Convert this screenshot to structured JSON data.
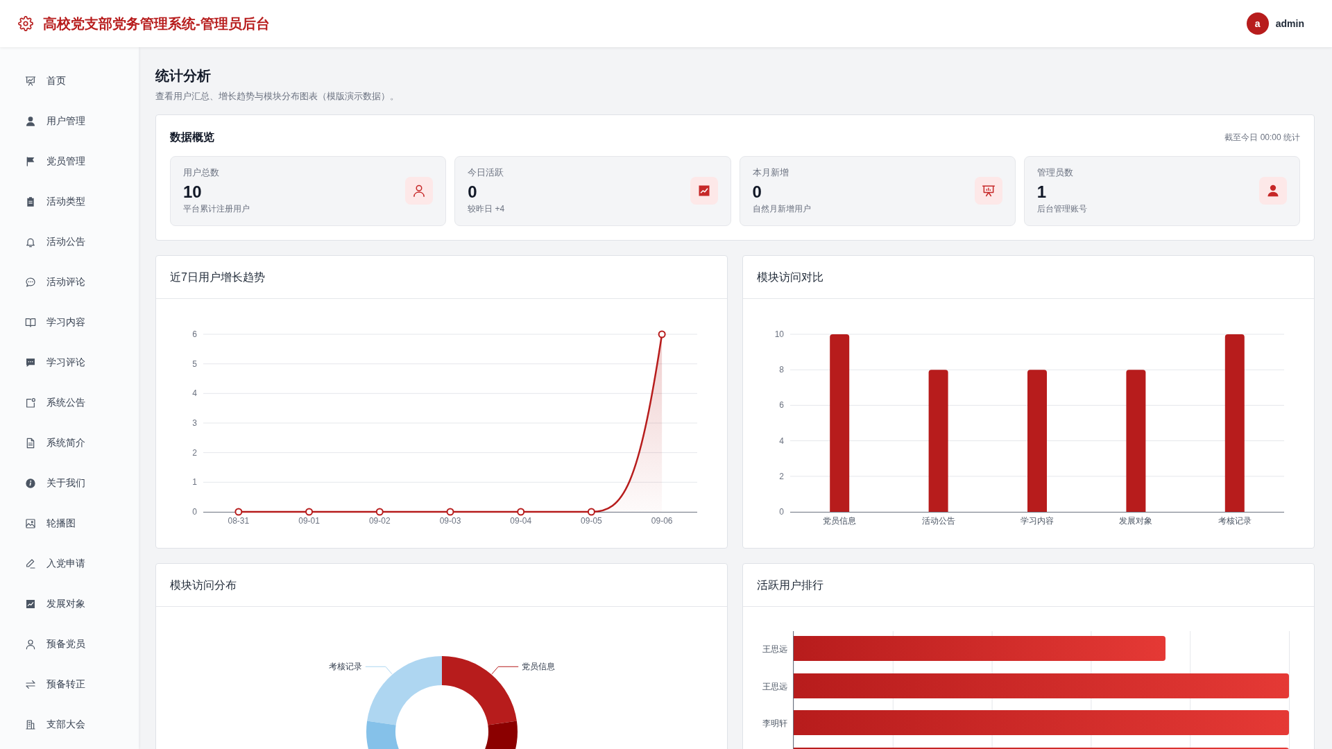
{
  "header": {
    "title": "高校党支部党务管理系统-管理员后台",
    "user": {
      "avatar": "a",
      "name": "admin"
    }
  },
  "sidebar": {
    "items": [
      {
        "label": "首页",
        "selected": false
      },
      {
        "label": "用户管理",
        "selected": false
      },
      {
        "label": "党员管理",
        "selected": false
      },
      {
        "label": "活动类型",
        "selected": false
      },
      {
        "label": "活动公告",
        "selected": false
      },
      {
        "label": "活动评论",
        "selected": false
      },
      {
        "label": "学习内容",
        "selected": false
      },
      {
        "label": "学习评论",
        "selected": false
      },
      {
        "label": "系统公告",
        "selected": false
      },
      {
        "label": "系统简介",
        "selected": false
      },
      {
        "label": "关于我们",
        "selected": false
      },
      {
        "label": "轮播图",
        "selected": false
      },
      {
        "label": "入党申请",
        "selected": false
      },
      {
        "label": "发展对象",
        "selected": false
      },
      {
        "label": "预备党员",
        "selected": false
      },
      {
        "label": "预备转正",
        "selected": false
      },
      {
        "label": "支部大会",
        "selected": false
      }
    ]
  },
  "page": {
    "title": "统计分析",
    "subtitle": "查看用户汇总、增长趋势与模块分布图表（模版演示数据）。"
  },
  "overview": {
    "title": "数据概览",
    "note": "截至今日 00:00 统计",
    "stats": [
      {
        "label": "用户总数",
        "value": "10",
        "caption": "平台累计注册用户"
      },
      {
        "label": "今日活跃",
        "value": "0",
        "caption": "较昨日 +4"
      },
      {
        "label": "本月新增",
        "value": "0",
        "caption": "自然月新增用户"
      },
      {
        "label": "管理员数",
        "value": "1",
        "caption": "后台管理账号"
      }
    ]
  },
  "growth": {
    "title": "近7日用户增长趋势",
    "chart_data": {
      "type": "line",
      "categories": [
        "08-31",
        "09-01",
        "09-02",
        "09-03",
        "09-04",
        "09-05",
        "09-06"
      ],
      "values": [
        0,
        0,
        0,
        0,
        0,
        0,
        6
      ],
      "ylim": [
        0,
        6
      ],
      "yticks": [
        0,
        1,
        2,
        3,
        4,
        5,
        6
      ],
      "grid": true,
      "marker": true
    }
  },
  "comparison": {
    "title": "模块访问对比",
    "chart_data": {
      "type": "bar",
      "categories": [
        "党员信息",
        "活动公告",
        "学习内容",
        "发展对象",
        "考核记录"
      ],
      "values": [
        10,
        8,
        8,
        8,
        10
      ],
      "ylim": [
        0,
        10
      ],
      "yticks": [
        0,
        2,
        4,
        6,
        8,
        10
      ],
      "grid": true
    }
  },
  "distribution": {
    "title": "模块访问分布",
    "slices": [
      {
        "label": "考核记录",
        "color": "#aed6f1"
      },
      {
        "color": "#85c1e9"
      },
      {
        "label": "党员信息",
        "color": "#b71c1c"
      },
      {
        "color": "#8b0000"
      }
    ]
  },
  "ranking": {
    "title": "活跃用户排行",
    "rows": [
      {
        "name": "王思远",
        "level": 0.75
      },
      {
        "name": "王思远",
        "level": 1
      },
      {
        "name": "李明轩",
        "level": 1
      },
      {
        "level": 1
      }
    ]
  }
}
